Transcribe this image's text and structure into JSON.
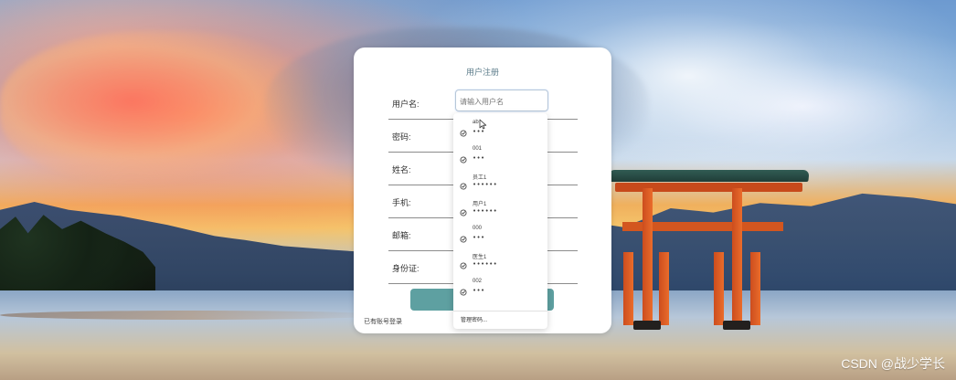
{
  "form": {
    "title": "用户注册",
    "fields": {
      "username": {
        "label": "用户名:",
        "placeholder": "请输入用户名"
      },
      "password": {
        "label": "密码:"
      },
      "name": {
        "label": "姓名:"
      },
      "phone": {
        "label": "手机:"
      },
      "email": {
        "label": "邮箱:"
      },
      "id_card": {
        "label": "身份证:"
      }
    },
    "already_have_account": "已有账号登录"
  },
  "autocomplete": {
    "items": [
      {
        "name": "ab",
        "masked_password": "•••"
      },
      {
        "name": "001",
        "masked_password": "•••"
      },
      {
        "name": "员工1",
        "masked_password": "••••••"
      },
      {
        "name": "用户1",
        "masked_password": "••••••"
      },
      {
        "name": "000",
        "masked_password": "•••"
      },
      {
        "name": "医生1",
        "masked_password": "••••••"
      },
      {
        "name": "002",
        "masked_password": "•••"
      }
    ],
    "manage_label": "管理密码..."
  },
  "watermark": "CSDN @战少学长",
  "colors": {
    "card_bg": "#ffffff",
    "title_color": "#5c7c8a",
    "button_color": "#5ea0a1",
    "line_color": "#8c8c8c"
  },
  "icons": {
    "suggestion": "key-icon",
    "cursor": "mouse-cursor-icon"
  }
}
